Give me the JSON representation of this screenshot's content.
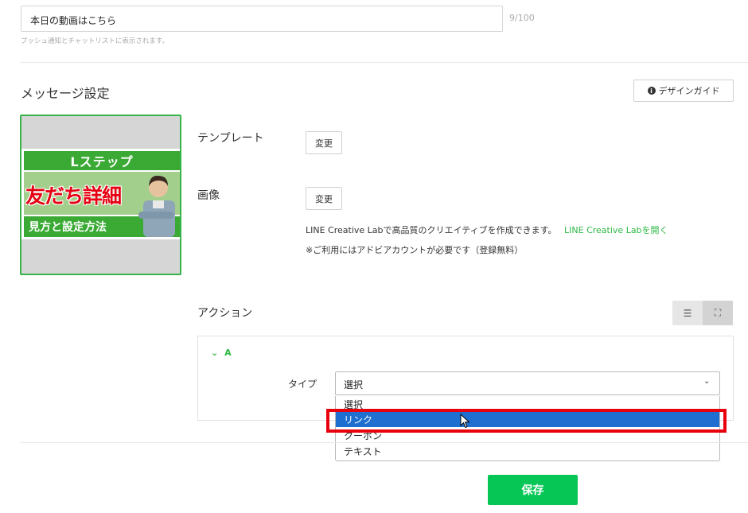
{
  "alt_text": {
    "value": "本日の動画はこちら",
    "counter": "9/100",
    "hint": "プッシュ通知とチャットリストに表示されます。"
  },
  "message_settings": {
    "title": "メッセージ設定",
    "design_guide_label": "デザインガイド",
    "info_icon": "info-icon"
  },
  "thumbnail": {
    "line1": "Lステップ",
    "line2": "友だち詳細",
    "line3": "見方と設定方法",
    "accent_green": "#3aaa35",
    "accent_red": "#e60012"
  },
  "template": {
    "label": "テンプレート",
    "change_label": "変更"
  },
  "image": {
    "label": "画像",
    "change_label": "変更",
    "note_text": "LINE Creative Labで高品質のクリエイティブを作成できます。",
    "note_link": "LINE Creative Labを開く",
    "note_sub": "※ご利用にはアドビアカウントが必要です（登録無料）"
  },
  "action": {
    "label": "アクション",
    "view_list_icon": "list-icon",
    "view_expand_icon": "expand-icon",
    "item_label": "A",
    "type_label": "タイプ",
    "type_selected": "選択",
    "options": [
      "選択",
      "リンク",
      "クーポン",
      "テキスト"
    ],
    "highlighted_option": "リンク"
  },
  "footer": {
    "save_label": "保存",
    "save_color": "#06c755"
  }
}
